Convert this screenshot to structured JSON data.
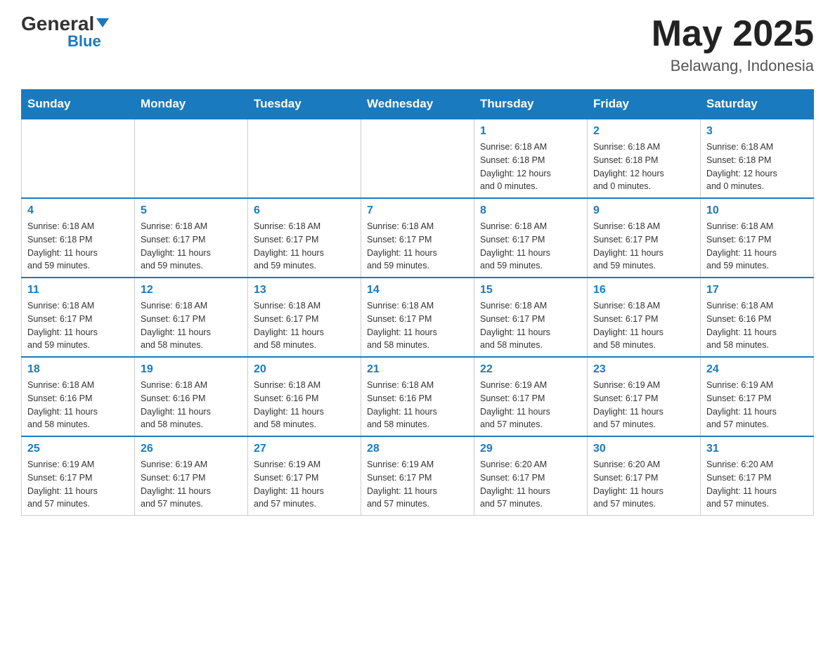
{
  "logo": {
    "general": "General",
    "triangle": "▲",
    "blue": "Blue"
  },
  "title": {
    "month_year": "May 2025",
    "location": "Belawang, Indonesia"
  },
  "days_of_week": [
    "Sunday",
    "Monday",
    "Tuesday",
    "Wednesday",
    "Thursday",
    "Friday",
    "Saturday"
  ],
  "weeks": [
    {
      "days": [
        {
          "num": "",
          "info": ""
        },
        {
          "num": "",
          "info": ""
        },
        {
          "num": "",
          "info": ""
        },
        {
          "num": "",
          "info": ""
        },
        {
          "num": "1",
          "info": "Sunrise: 6:18 AM\nSunset: 6:18 PM\nDaylight: 12 hours\nand 0 minutes."
        },
        {
          "num": "2",
          "info": "Sunrise: 6:18 AM\nSunset: 6:18 PM\nDaylight: 12 hours\nand 0 minutes."
        },
        {
          "num": "3",
          "info": "Sunrise: 6:18 AM\nSunset: 6:18 PM\nDaylight: 12 hours\nand 0 minutes."
        }
      ]
    },
    {
      "days": [
        {
          "num": "4",
          "info": "Sunrise: 6:18 AM\nSunset: 6:18 PM\nDaylight: 11 hours\nand 59 minutes."
        },
        {
          "num": "5",
          "info": "Sunrise: 6:18 AM\nSunset: 6:17 PM\nDaylight: 11 hours\nand 59 minutes."
        },
        {
          "num": "6",
          "info": "Sunrise: 6:18 AM\nSunset: 6:17 PM\nDaylight: 11 hours\nand 59 minutes."
        },
        {
          "num": "7",
          "info": "Sunrise: 6:18 AM\nSunset: 6:17 PM\nDaylight: 11 hours\nand 59 minutes."
        },
        {
          "num": "8",
          "info": "Sunrise: 6:18 AM\nSunset: 6:17 PM\nDaylight: 11 hours\nand 59 minutes."
        },
        {
          "num": "9",
          "info": "Sunrise: 6:18 AM\nSunset: 6:17 PM\nDaylight: 11 hours\nand 59 minutes."
        },
        {
          "num": "10",
          "info": "Sunrise: 6:18 AM\nSunset: 6:17 PM\nDaylight: 11 hours\nand 59 minutes."
        }
      ]
    },
    {
      "days": [
        {
          "num": "11",
          "info": "Sunrise: 6:18 AM\nSunset: 6:17 PM\nDaylight: 11 hours\nand 59 minutes."
        },
        {
          "num": "12",
          "info": "Sunrise: 6:18 AM\nSunset: 6:17 PM\nDaylight: 11 hours\nand 58 minutes."
        },
        {
          "num": "13",
          "info": "Sunrise: 6:18 AM\nSunset: 6:17 PM\nDaylight: 11 hours\nand 58 minutes."
        },
        {
          "num": "14",
          "info": "Sunrise: 6:18 AM\nSunset: 6:17 PM\nDaylight: 11 hours\nand 58 minutes."
        },
        {
          "num": "15",
          "info": "Sunrise: 6:18 AM\nSunset: 6:17 PM\nDaylight: 11 hours\nand 58 minutes."
        },
        {
          "num": "16",
          "info": "Sunrise: 6:18 AM\nSunset: 6:17 PM\nDaylight: 11 hours\nand 58 minutes."
        },
        {
          "num": "17",
          "info": "Sunrise: 6:18 AM\nSunset: 6:16 PM\nDaylight: 11 hours\nand 58 minutes."
        }
      ]
    },
    {
      "days": [
        {
          "num": "18",
          "info": "Sunrise: 6:18 AM\nSunset: 6:16 PM\nDaylight: 11 hours\nand 58 minutes."
        },
        {
          "num": "19",
          "info": "Sunrise: 6:18 AM\nSunset: 6:16 PM\nDaylight: 11 hours\nand 58 minutes."
        },
        {
          "num": "20",
          "info": "Sunrise: 6:18 AM\nSunset: 6:16 PM\nDaylight: 11 hours\nand 58 minutes."
        },
        {
          "num": "21",
          "info": "Sunrise: 6:18 AM\nSunset: 6:16 PM\nDaylight: 11 hours\nand 58 minutes."
        },
        {
          "num": "22",
          "info": "Sunrise: 6:19 AM\nSunset: 6:17 PM\nDaylight: 11 hours\nand 57 minutes."
        },
        {
          "num": "23",
          "info": "Sunrise: 6:19 AM\nSunset: 6:17 PM\nDaylight: 11 hours\nand 57 minutes."
        },
        {
          "num": "24",
          "info": "Sunrise: 6:19 AM\nSunset: 6:17 PM\nDaylight: 11 hours\nand 57 minutes."
        }
      ]
    },
    {
      "days": [
        {
          "num": "25",
          "info": "Sunrise: 6:19 AM\nSunset: 6:17 PM\nDaylight: 11 hours\nand 57 minutes."
        },
        {
          "num": "26",
          "info": "Sunrise: 6:19 AM\nSunset: 6:17 PM\nDaylight: 11 hours\nand 57 minutes."
        },
        {
          "num": "27",
          "info": "Sunrise: 6:19 AM\nSunset: 6:17 PM\nDaylight: 11 hours\nand 57 minutes."
        },
        {
          "num": "28",
          "info": "Sunrise: 6:19 AM\nSunset: 6:17 PM\nDaylight: 11 hours\nand 57 minutes."
        },
        {
          "num": "29",
          "info": "Sunrise: 6:20 AM\nSunset: 6:17 PM\nDaylight: 11 hours\nand 57 minutes."
        },
        {
          "num": "30",
          "info": "Sunrise: 6:20 AM\nSunset: 6:17 PM\nDaylight: 11 hours\nand 57 minutes."
        },
        {
          "num": "31",
          "info": "Sunrise: 6:20 AM\nSunset: 6:17 PM\nDaylight: 11 hours\nand 57 minutes."
        }
      ]
    }
  ]
}
